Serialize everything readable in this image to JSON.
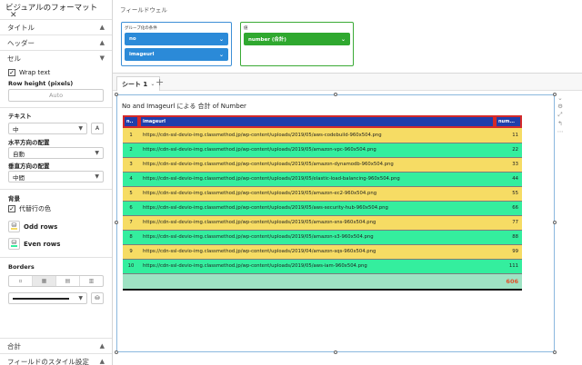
{
  "panel": {
    "title": "ビジュアルのフォーマット",
    "close": "✕",
    "sections": {
      "title": "タイトル",
      "header": "ヘッダー",
      "cell": "セル",
      "total": "合計",
      "field_style": "フィールドのスタイル設定"
    },
    "cell": {
      "wrap_text": "Wrap text",
      "row_height_label": "Row height (pixels)",
      "row_height_placeholder": "Auto",
      "text_label": "テキスト",
      "text_size": "中",
      "h_align_label": "水平方向の配置",
      "h_align_value": "自動",
      "v_align_label": "垂直方向の配置",
      "v_align_value": "中間",
      "background_label": "背景",
      "alternate_color": "代替行の色",
      "odd_rows": "Odd rows",
      "even_rows": "Even rows",
      "borders_label": "Borders"
    }
  },
  "wells": {
    "title": "フィールドウェル",
    "group_by": {
      "title": "グループ化の条件",
      "fields": [
        "no",
        "imageurl"
      ]
    },
    "value": {
      "title": "値",
      "fields": [
        "number (合計)"
      ]
    }
  },
  "tabs": {
    "active": "シート 1",
    "add": "+"
  },
  "visual": {
    "title": "No and Imageurl による 合計 of Number",
    "columns": [
      "n..",
      "imageurl",
      "num..."
    ],
    "rows": [
      {
        "no": "1",
        "url": "https://cdn-ssl-devio-img.classmethod.jp/wp-content/uploads/2019/05/aws-codebuild-960x504.png",
        "num": "11"
      },
      {
        "no": "2",
        "url": "https://cdn-ssl-devio-img.classmethod.jp/wp-content/uploads/2019/05/amazon-vpc-960x504.png",
        "num": "22"
      },
      {
        "no": "3",
        "url": "https://cdn-ssl-devio-img.classmethod.jp/wp-content/uploads/2019/05/amazon-dynamodb-960x504.png",
        "num": "33"
      },
      {
        "no": "4",
        "url": "https://cdn-ssl-devio-img.classmethod.jp/wp-content/uploads/2019/05/elastic-load-balancing-960x504.png",
        "num": "44"
      },
      {
        "no": "5",
        "url": "https://cdn-ssl-devio-img.classmethod.jp/wp-content/uploads/2019/05/amazon-ec2-960x504.png",
        "num": "55"
      },
      {
        "no": "6",
        "url": "https://cdn-ssl-devio-img.classmethod.jp/wp-content/uploads/2019/05/aws-security-hub-960x504.png",
        "num": "66"
      },
      {
        "no": "7",
        "url": "https://cdn-ssl-devio-img.classmethod.jp/wp-content/uploads/2019/05/amazon-sns-960x504.png",
        "num": "77"
      },
      {
        "no": "8",
        "url": "https://cdn-ssl-devio-img.classmethod.jp/wp-content/uploads/2019/05/amazon-s3-960x504.png",
        "num": "88"
      },
      {
        "no": "9",
        "url": "https://cdn-ssl-devio-img.classmethod.jp/wp-content/uploads/2019/04/amazon-sqs-960x504.png",
        "num": "99"
      },
      {
        "no": "10",
        "url": "https://cdn-ssl-devio-img.classmethod.jp/wp-content/uploads/2019/05/aws-iam-960x504.png",
        "num": "111"
      }
    ],
    "total": "606"
  },
  "colors": {
    "header_bg": "#1f3eac",
    "odd_row": "#f6dc64",
    "even_row": "#34ee9e",
    "total_row": "#9ee3c3",
    "total_text": "#e0522a",
    "well_blue": "#2b8ad8",
    "well_green": "#2fa82f"
  }
}
